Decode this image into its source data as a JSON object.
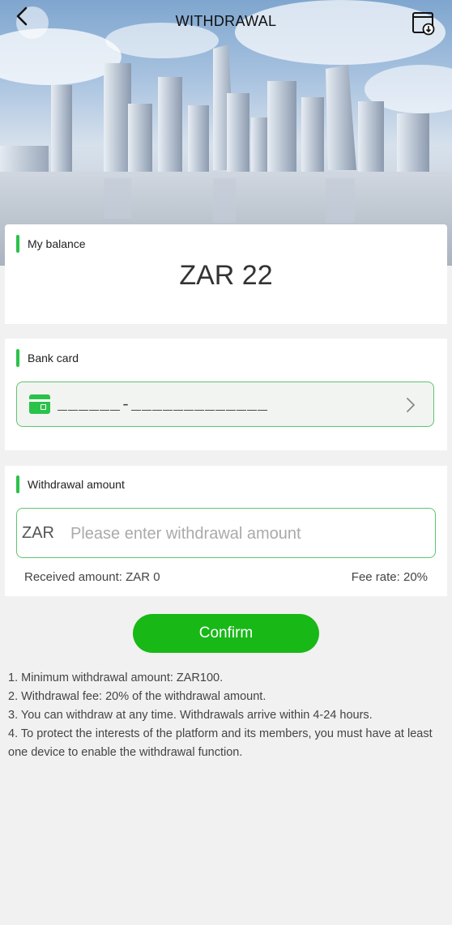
{
  "header": {
    "title": "WITHDRAWAL",
    "back_icon": "chevron-left-icon",
    "records_icon": "download-record-icon"
  },
  "balance": {
    "label": "My balance",
    "value": "ZAR 22"
  },
  "bank_card": {
    "label": "Bank card",
    "card_number": "______-_____________",
    "icon": "credit-card-icon"
  },
  "withdrawal": {
    "label": "Withdrawal amount",
    "currency": "ZAR",
    "placeholder": "Please enter withdrawal amount",
    "value": "",
    "received_text": "Received amount: ZAR 0",
    "fee_text": "Fee rate: 20%"
  },
  "confirm": {
    "label": "Confirm"
  },
  "notes": [
    "1. Minimum withdrawal amount: ZAR100.",
    "2. Withdrawal fee: 20% of the withdrawal amount.",
    "3. You can withdraw at any time. Withdrawals arrive within 4-24 hours.",
    "4. To protect the interests of the platform and its members, you must have at least one device to enable the withdrawal function."
  ],
  "colors": {
    "accent": "#2bc24a",
    "button": "#18b817",
    "background": "#f1f1f1"
  }
}
